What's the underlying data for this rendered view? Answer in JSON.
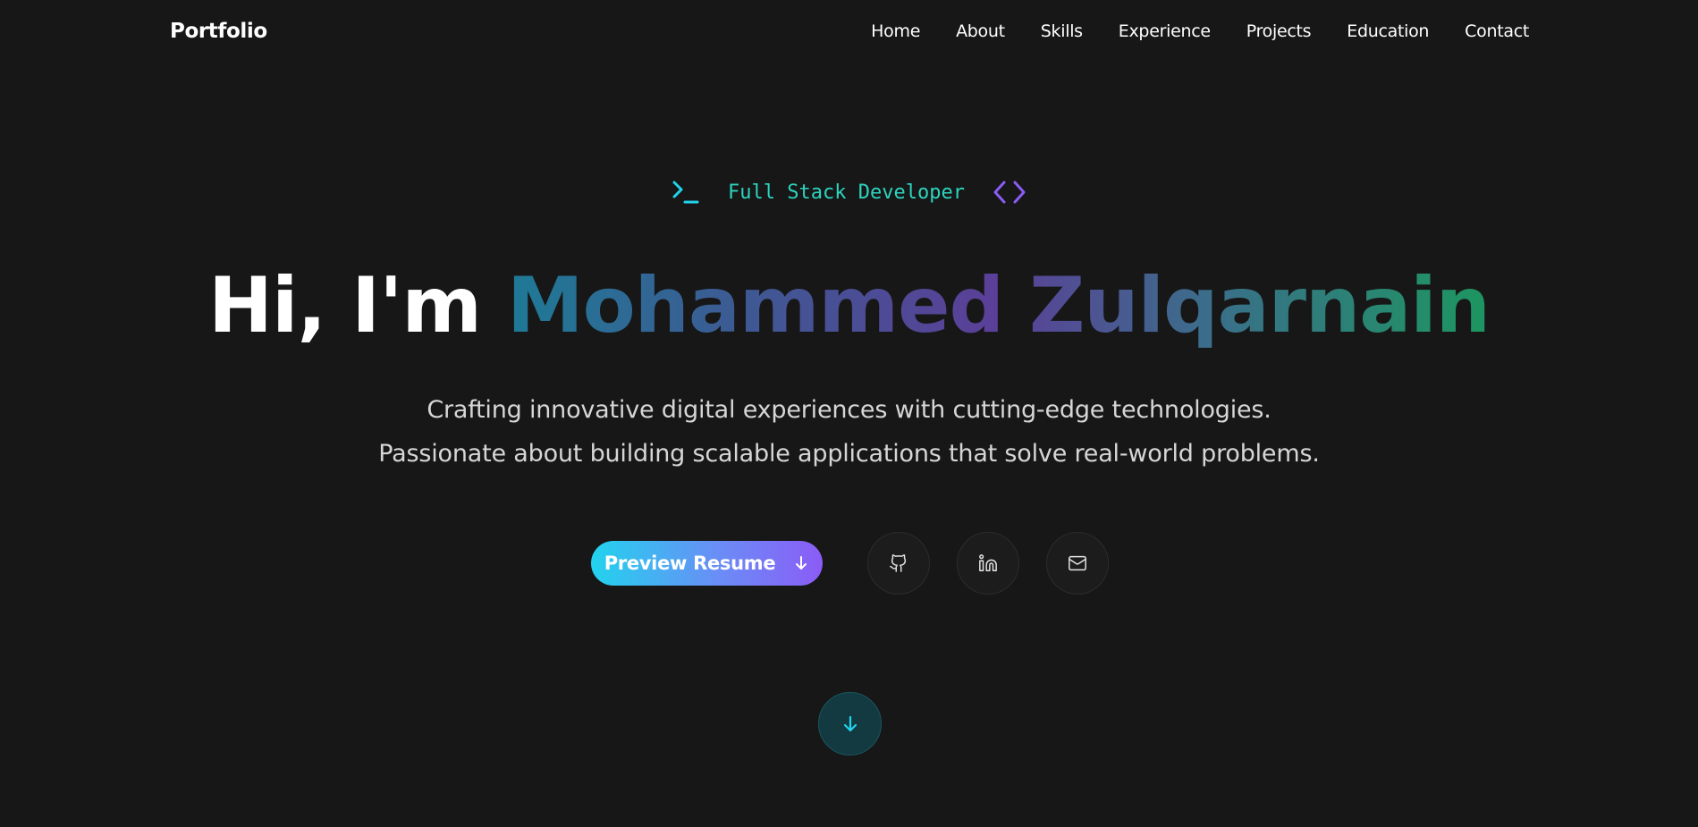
{
  "nav": {
    "brand": "Portfolio",
    "links": [
      {
        "label": "Home"
      },
      {
        "label": "About"
      },
      {
        "label": "Skills"
      },
      {
        "label": "Experience"
      },
      {
        "label": "Projects"
      },
      {
        "label": "Education"
      },
      {
        "label": "Contact"
      }
    ]
  },
  "hero": {
    "role": "Full Stack Developer",
    "greeting": "Hi, I'm",
    "name": "Mohammed Zulqarnain",
    "tagline_line1": "Crafting innovative digital experiences with cutting-edge technologies.",
    "tagline_line2": "Passionate about building scalable applications that solve real-world problems.",
    "resume_button": "Preview Resume"
  },
  "icons": {
    "role_left": "terminal-icon",
    "role_right": "code-icon",
    "resume": "arrow-down-icon",
    "social": [
      "github-icon",
      "linkedin-icon",
      "mail-icon"
    ],
    "scroll": "arrow-down-icon"
  },
  "colors": {
    "background": "#171717",
    "accent_cyan": "#22d3ee",
    "accent_purple": "#8b5cf6",
    "accent_teal": "#2dd4bf"
  }
}
